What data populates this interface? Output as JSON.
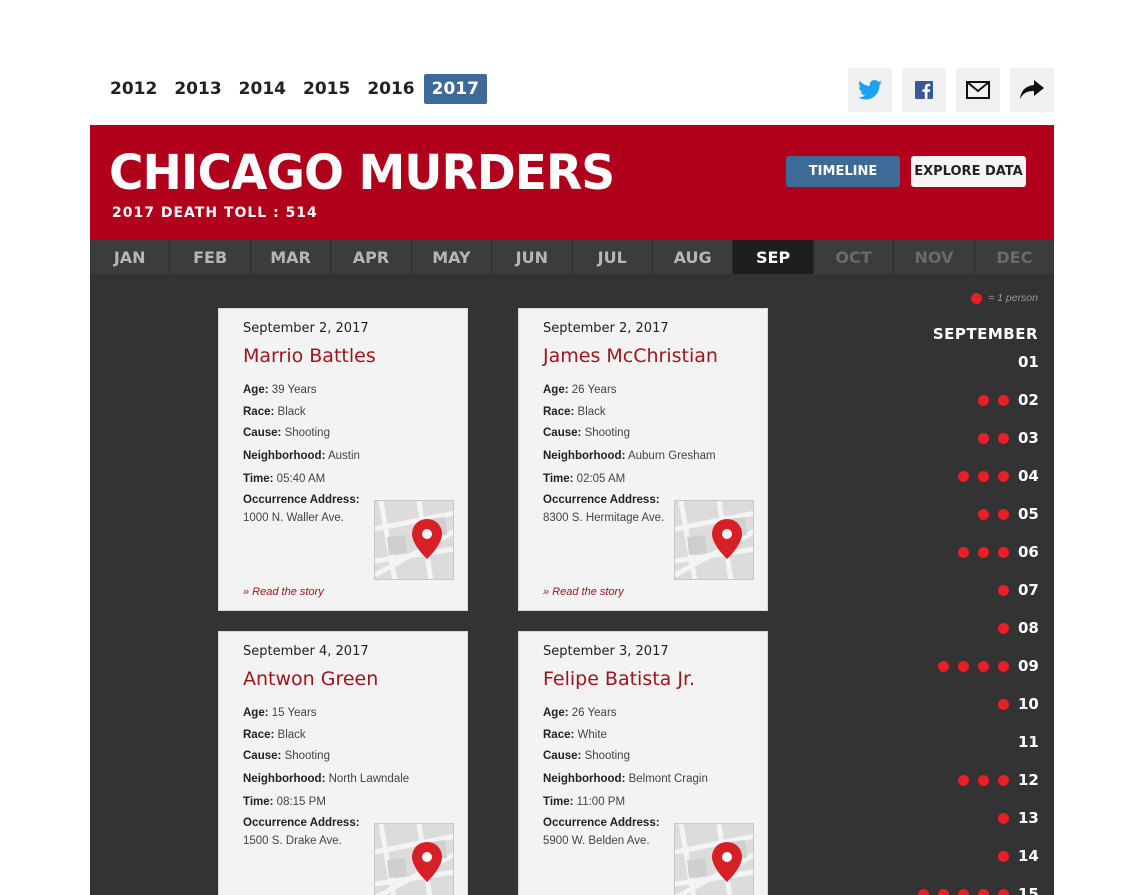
{
  "years": [
    "2012",
    "2013",
    "2014",
    "2015",
    "2016",
    "2017"
  ],
  "active_year": "2017",
  "share": {
    "icons": [
      "twitter-icon",
      "facebook-icon",
      "mail-icon",
      "share-icon"
    ]
  },
  "banner": {
    "title": "CHICAGO MURDERS",
    "death_toll": "2017 DEATH TOLL : 514",
    "timeline_label": "TIMELINE",
    "explore_label": "EXPLORE DATA"
  },
  "months": [
    {
      "label": "JAN",
      "state": "normal"
    },
    {
      "label": "FEB",
      "state": "normal"
    },
    {
      "label": "MAR",
      "state": "normal"
    },
    {
      "label": "APR",
      "state": "normal"
    },
    {
      "label": "MAY",
      "state": "normal"
    },
    {
      "label": "JUN",
      "state": "normal"
    },
    {
      "label": "JUL",
      "state": "normal"
    },
    {
      "label": "AUG",
      "state": "normal"
    },
    {
      "label": "SEP",
      "state": "active"
    },
    {
      "label": "OCT",
      "state": "disabled"
    },
    {
      "label": "NOV",
      "state": "disabled"
    },
    {
      "label": "DEC",
      "state": "disabled"
    }
  ],
  "field_labels": {
    "age": "Age:",
    "race": "Race:",
    "cause": "Cause:",
    "neighborhood": "Neighborhood:",
    "time": "Time:",
    "address": "Occurrence Address:",
    "read_story": "» Read the story"
  },
  "cards": [
    {
      "date": "September 2, 2017",
      "name": "Marrio Battles",
      "age": "39 Years",
      "race": "Black",
      "cause": "Shooting",
      "neighborhood": "Austin",
      "time": "05:40 AM",
      "address": "1000 N. Waller Ave."
    },
    {
      "date": "September 2, 2017",
      "name": "James McChristian",
      "age": "26 Years",
      "race": "Black",
      "cause": "Shooting",
      "neighborhood": "Auburn Gresham",
      "time": "02:05 AM",
      "address": "8300 S. Hermitage Ave."
    },
    {
      "date": "September 4, 2017",
      "name": "Antwon Green",
      "age": "15 Years",
      "race": "Black",
      "cause": "Shooting",
      "neighborhood": "North Lawndale",
      "time": "08:15 PM",
      "address": "1500 S. Drake Ave."
    },
    {
      "date": "September 3, 2017",
      "name": "Felipe Batista Jr.",
      "age": "26 Years",
      "race": "White",
      "cause": "Shooting",
      "neighborhood": "Belmont Cragin",
      "time": "11:00 PM",
      "address": "5900 W. Belden Ave."
    }
  ],
  "legend_text": "= 1 person",
  "timeline": {
    "month_label": "SEPTEMBER",
    "days": [
      {
        "day": "01",
        "count": 0
      },
      {
        "day": "02",
        "count": 2
      },
      {
        "day": "03",
        "count": 2
      },
      {
        "day": "04",
        "count": 3
      },
      {
        "day": "05",
        "count": 2
      },
      {
        "day": "06",
        "count": 3
      },
      {
        "day": "07",
        "count": 1
      },
      {
        "day": "08",
        "count": 1
      },
      {
        "day": "09",
        "count": 4
      },
      {
        "day": "10",
        "count": 1
      },
      {
        "day": "11",
        "count": 0
      },
      {
        "day": "12",
        "count": 3
      },
      {
        "day": "13",
        "count": 1
      },
      {
        "day": "14",
        "count": 1
      },
      {
        "day": "15",
        "count": 5
      }
    ]
  },
  "colors": {
    "brand_red": "#b0001b",
    "accent_blue": "#3d6a96",
    "dot_red": "#e81f26"
  }
}
